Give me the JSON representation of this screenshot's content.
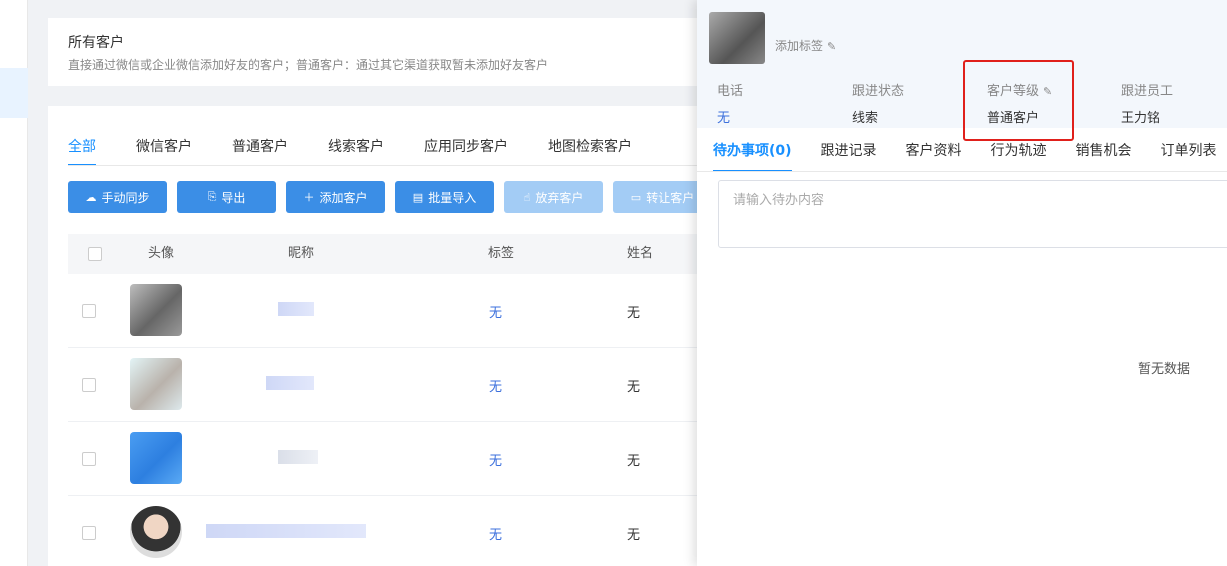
{
  "header": {
    "title": "所有客户",
    "description": "直接通过微信或企业微信添加好友的客户；普通客户：通过其它渠道获取暂未添加好友客户"
  },
  "tabs": [
    {
      "label": "全部",
      "active": true
    },
    {
      "label": "微信客户"
    },
    {
      "label": "普通客户"
    },
    {
      "label": "线索客户"
    },
    {
      "label": "应用同步客户"
    },
    {
      "label": "地图检索客户"
    }
  ],
  "toolbar": {
    "sync": "手动同步",
    "export": "导出",
    "add": "添加客户",
    "import": "批量导入",
    "abandon": "放弃客户",
    "transfer": "转让客户"
  },
  "table": {
    "headers": {
      "avatar": "头像",
      "nickname": "昵称",
      "tag": "标签",
      "name": "姓名"
    },
    "rows": [
      {
        "tag": "无",
        "name": "无"
      },
      {
        "tag": "无",
        "name": "无"
      },
      {
        "tag": "无",
        "name": "无"
      },
      {
        "tag": "无",
        "name": "无"
      }
    ]
  },
  "panel": {
    "add_tag": "添加标签",
    "fields": {
      "phone": {
        "label": "电话",
        "value": "无"
      },
      "follow_status": {
        "label": "跟进状态",
        "value": "线索"
      },
      "customer_level": {
        "label": "客户等级",
        "value": "普通客户"
      },
      "follower": {
        "label": "跟进员工",
        "value": "王力铭"
      }
    },
    "tabs": [
      {
        "label": "待办事项(0)",
        "active": true
      },
      {
        "label": "跟进记录"
      },
      {
        "label": "客户资料"
      },
      {
        "label": "行为轨迹"
      },
      {
        "label": "销售机会"
      },
      {
        "label": "订单列表"
      }
    ],
    "todo_placeholder": "请输入待办内容",
    "empty_text": "暂无数据"
  },
  "colors": {
    "primary": "#1890ff",
    "button": "#3b8ee6",
    "highlight": "#e0201b"
  }
}
